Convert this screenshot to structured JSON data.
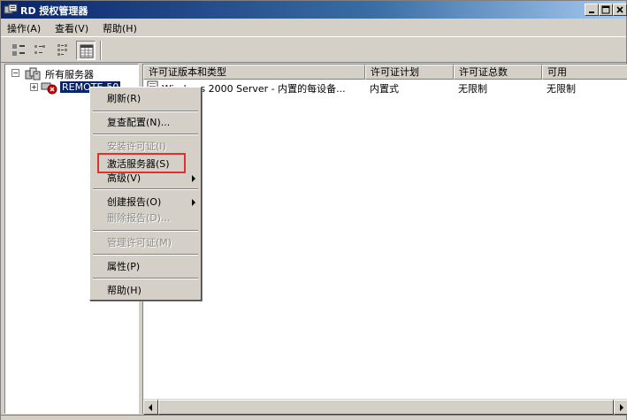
{
  "window": {
    "title": "RD 授权管理器",
    "icon": "server-license-icon"
  },
  "menubar": {
    "items": [
      {
        "label": "操作(A)"
      },
      {
        "label": "查看(V)"
      },
      {
        "label": "帮助(H)"
      }
    ]
  },
  "toolbar": {
    "buttons": [
      {
        "icon": "large-icons-view-icon"
      },
      {
        "icon": "small-icons-view-icon"
      },
      {
        "icon": "list-view-icon"
      },
      {
        "icon": "details-view-icon",
        "active": true
      }
    ]
  },
  "tree": {
    "root": {
      "label": "所有服务器",
      "icon": "server-group-icon",
      "expanded": true
    },
    "child": {
      "label": "REMOTE-50",
      "icon": "server-error-icon",
      "selected": true
    }
  },
  "list": {
    "columns": [
      "许可证版本和类型",
      "许可证计划",
      "许可证总数",
      "可用"
    ],
    "rows": [
      {
        "icon": "license-document-icon",
        "cells": [
          "Windows 2000 Server - 内置的每设备...",
          "内置式",
          "无限制",
          "无限制"
        ]
      }
    ]
  },
  "context_menu": {
    "items": [
      {
        "label": "刷新(R)",
        "disabled": false
      },
      {
        "label": "复查配置(N)...",
        "disabled": false
      },
      {
        "label": "安装许可证(I)",
        "disabled": true
      },
      {
        "label": "激活服务器(S)",
        "disabled": false,
        "highlighted": true
      },
      {
        "label": "高级(V)",
        "disabled": false,
        "submenu": true
      },
      {
        "label": "创建报告(O)",
        "disabled": false,
        "submenu": true
      },
      {
        "label": "删除报告(D)...",
        "disabled": true
      },
      {
        "label": "管理许可证(M)",
        "disabled": true
      },
      {
        "label": "属性(P)",
        "disabled": false
      },
      {
        "label": "帮助(H)",
        "disabled": false
      }
    ]
  },
  "colors": {
    "titlebar_start": "#0a246a",
    "selection": "#0a246a",
    "highlight_box": "#e03030",
    "chrome": "#d4d0c8"
  }
}
